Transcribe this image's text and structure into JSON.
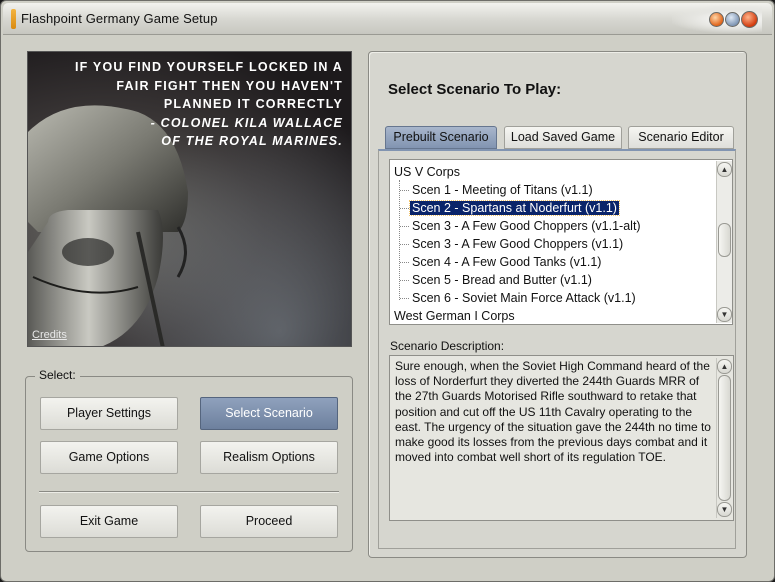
{
  "window": {
    "title": "Flashpoint Germany Game Setup",
    "accent_color": "#e09a20"
  },
  "poster": {
    "quote_lines": [
      "If you find yourself locked in a",
      "fair fight then you haven't",
      "planned it correctly",
      "- Colonel Kila Wallace",
      "of the Royal Marines."
    ],
    "credits_label": "Credits"
  },
  "select_group": {
    "label": "Select:",
    "buttons": {
      "player_settings": "Player Settings",
      "select_scenario": "Select Scenario",
      "game_options": "Game Options",
      "realism_options": "Realism Options",
      "exit_game": "Exit Game",
      "proceed": "Proceed"
    },
    "active_button": "select_scenario",
    "active_color": "#7b8eab"
  },
  "scenario_panel": {
    "title": "Select Scenario To Play:",
    "tabs": [
      {
        "label": "Prebuilt Scenario",
        "active": true
      },
      {
        "label": "Load Saved Game",
        "active": false
      },
      {
        "label": "Scenario Editor",
        "active": false
      }
    ],
    "tree": {
      "group1": "US V Corps",
      "scenarios": [
        "Scen 1 - Meeting of Titans (v1.1)",
        "Scen 2 - Spartans at Noderfurt (v1.1)",
        "Scen 3 - A Few Good Choppers (v1.1-alt)",
        "Scen 3 - A Few Good Choppers (v1.1)",
        "Scen 4 - A Few Good Tanks (v1.1)",
        "Scen 5 - Bread and Butter (v1.1)",
        "Scen 6 - Soviet Main Force Attack (v1.1)"
      ],
      "group2": "West German I Corps",
      "selected_index": 1,
      "selection_color": "#0a246a"
    },
    "description_label": "Scenario Description:",
    "description": "Sure enough, when the Soviet High Command heard of the loss of Norderfurt they diverted the 244th Guards MRR of the 27th Guards Motorised Rifle southward to retake that position and cut off the US 11th Cavalry operating to the east. The urgency of the situation gave the 244th no time to make good its losses from the previous days combat and it moved into combat well short of its regulation TOE."
  }
}
